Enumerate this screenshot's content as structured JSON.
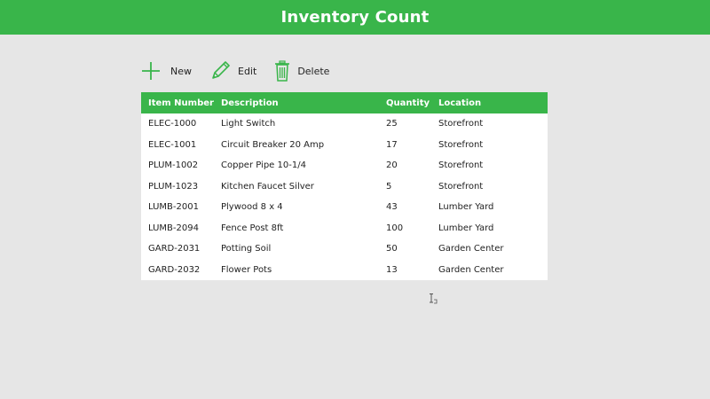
{
  "header": {
    "title": "Inventory Count"
  },
  "toolbar": {
    "new_label": "New",
    "edit_label": "Edit",
    "delete_label": "Delete",
    "accent_color": "#39b54a"
  },
  "table": {
    "columns": [
      "Item Number",
      "Description",
      "Quantity",
      "Location"
    ],
    "rows": [
      [
        "ELEC-1000",
        "Light Switch",
        "25",
        "Storefront"
      ],
      [
        "ELEC-1001",
        "Circuit Breaker 20 Amp",
        "17",
        "Storefront"
      ],
      [
        "PLUM-1002",
        "Copper Pipe 10-1/4",
        "20",
        "Storefront"
      ],
      [
        "PLUM-1023",
        "Kitchen Faucet Silver",
        "5",
        "Storefront"
      ],
      [
        "LUMB-2001",
        "Plywood 8 x 4",
        "43",
        "Lumber Yard"
      ],
      [
        "LUMB-2094",
        "Fence Post 8ft",
        "100",
        "Lumber Yard"
      ],
      [
        "GARD-2031",
        "Potting Soil",
        "50",
        "Garden Center"
      ],
      [
        "GARD-2032",
        "Flower Pots",
        "13",
        "Garden Center"
      ]
    ]
  },
  "colors": {
    "header_bg": "#39b54a",
    "page_bg": "#e6e6e6"
  },
  "icons": {
    "new": "plus-icon",
    "edit": "pencil-icon",
    "delete": "trash-icon",
    "cursor": "text-cursor-icon"
  }
}
